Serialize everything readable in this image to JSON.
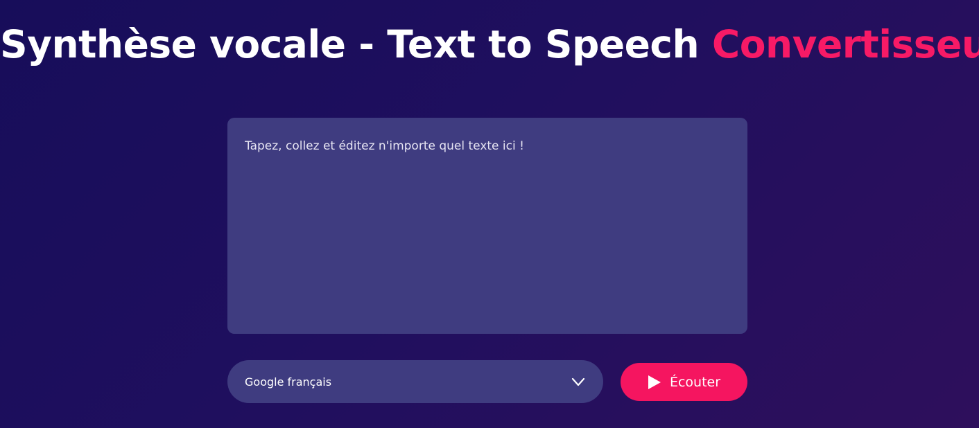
{
  "header": {
    "title_main": "Synthèse vocale - Text to Speech ",
    "title_accent": "Convertisseur"
  },
  "editor": {
    "placeholder": "Tapez, collez et éditez n'importe quel texte ici !",
    "value": ""
  },
  "voice": {
    "selected": "Google français",
    "icon": "chevron-down-icon"
  },
  "listen": {
    "label": "Écouter",
    "icon": "play-icon"
  },
  "colors": {
    "background": "#1f0f5e",
    "panel": "#3f3c80",
    "accent": "#f51560"
  }
}
